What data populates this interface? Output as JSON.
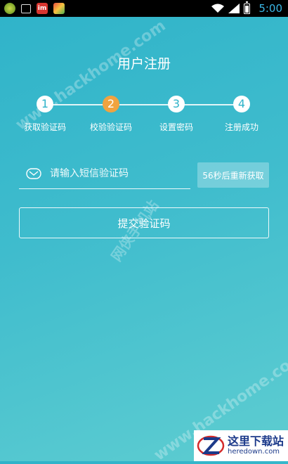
{
  "status_bar": {
    "clock": "5:00",
    "icons": [
      "globe-icon",
      "bag-icon",
      "im-icon",
      "app-icon",
      "wifi-icon",
      "signal-icon",
      "battery-icon"
    ],
    "im_label": "im"
  },
  "page": {
    "title": "用户注册"
  },
  "steps": [
    {
      "number": "1",
      "label": "获取验证码"
    },
    {
      "number": "2",
      "label": "校验验证码"
    },
    {
      "number": "3",
      "label": "设置密码"
    },
    {
      "number": "4",
      "label": "注册成功"
    }
  ],
  "active_step": 2,
  "code": {
    "placeholder": "请输入短信验证码",
    "value": "",
    "resend_label": "56秒后重新获取"
  },
  "submit_label": "提交验证码",
  "watermarks": {
    "site1": "www.hackhome.com",
    "site2": "网侠手机站",
    "site3": "www.hackhome.com"
  },
  "brand": {
    "cn": "这里下载站",
    "en": "heredown.com"
  },
  "colors": {
    "accent": "#f0a340",
    "background": "#3fbccd",
    "clock": "#3ab7e6"
  }
}
